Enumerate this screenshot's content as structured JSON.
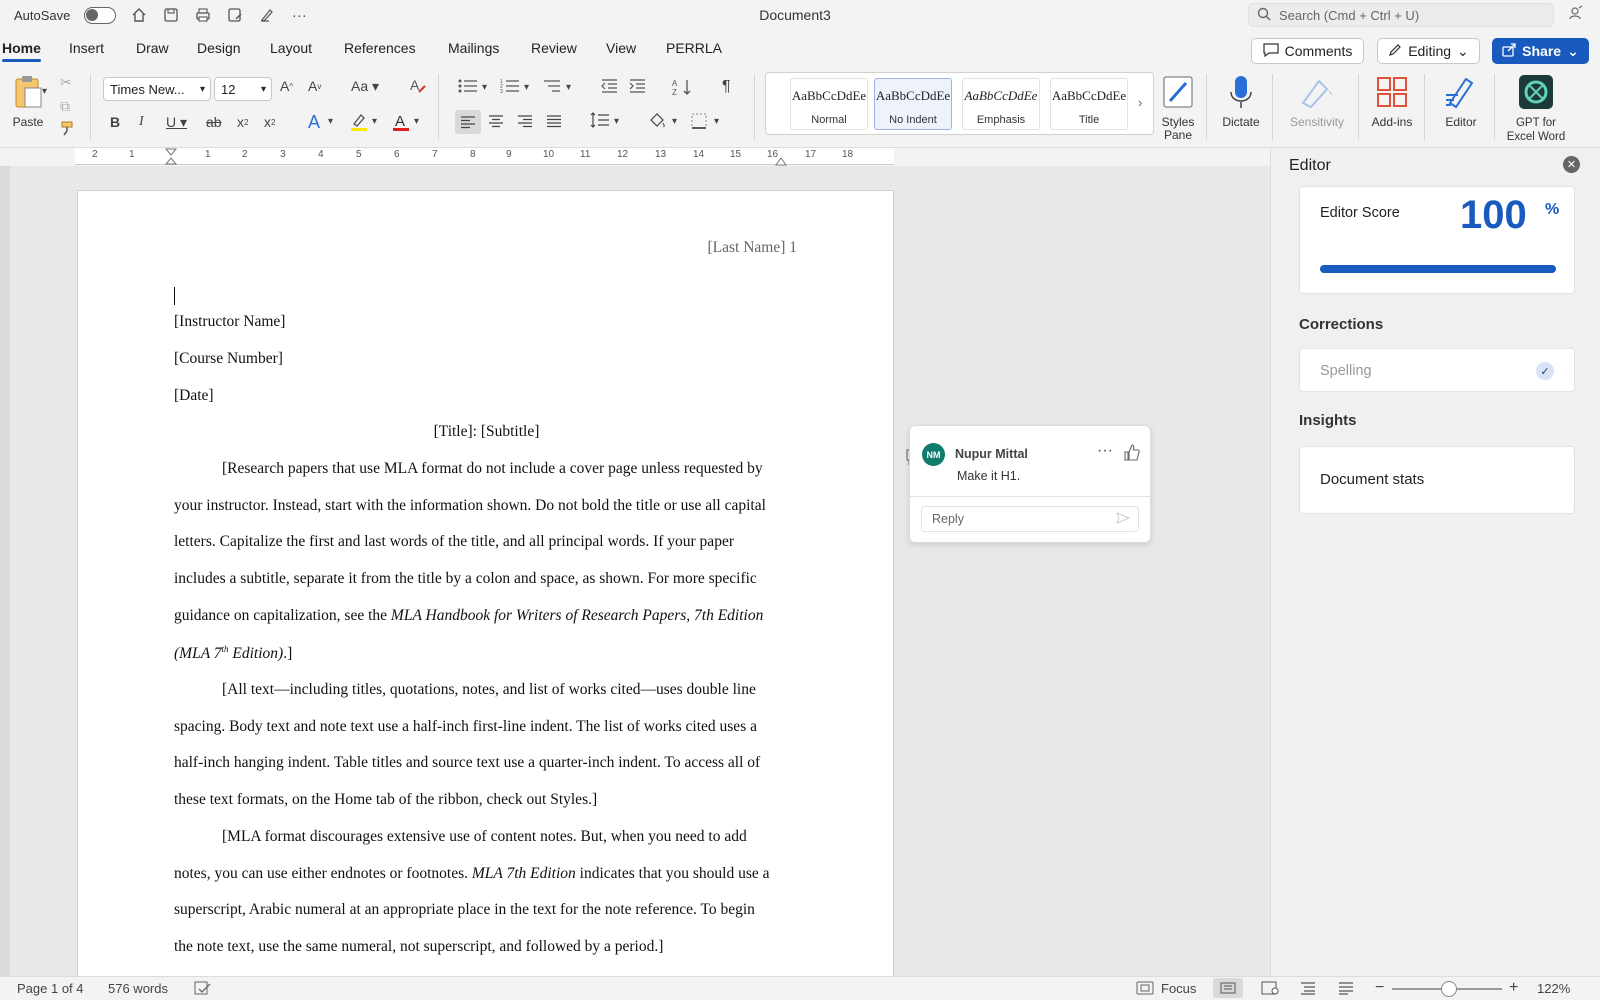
{
  "titlebar": {
    "autosave_label": "AutoSave",
    "document_title": "Document3",
    "search_placeholder": "Search (Cmd + Ctrl + U)",
    "icons": [
      "home-icon",
      "save-icon",
      "print-icon",
      "save-as-icon",
      "pen-icon",
      "more-icon"
    ]
  },
  "tabs": [
    "Home",
    "Insert",
    "Draw",
    "Design",
    "Layout",
    "References",
    "Mailings",
    "Review",
    "View",
    "PERRLA"
  ],
  "actions": {
    "comments": "Comments",
    "editing": "Editing",
    "share": "Share"
  },
  "ribbon": {
    "paste_label": "Paste",
    "font_name": "Times New...",
    "font_size": "12",
    "styles": [
      {
        "sample": "AaBbCcDdEe",
        "name": "Normal"
      },
      {
        "sample": "AaBbCcDdEe",
        "name": "No Indent"
      },
      {
        "sample": "AaBbCcDdEe",
        "name": "Emphasis"
      },
      {
        "sample": "AaBbCcDdEe",
        "name": "Title"
      }
    ],
    "styles_pane": "Styles\nPane",
    "dictate": "Dictate",
    "sensitivity": "Sensitivity",
    "addins": "Add-ins",
    "editor": "Editor",
    "gpt": "GPT for\nExcel Word"
  },
  "ruler": {
    "labels": [
      "2",
      "1",
      "1",
      "2",
      "3",
      "4",
      "5",
      "6",
      "7",
      "8",
      "9",
      "10",
      "11",
      "12",
      "13",
      "14",
      "15",
      "16",
      "17",
      "18"
    ]
  },
  "document": {
    "header": "[Last Name] 1",
    "lines": [
      "[Instructor Name]",
      "[Course Number]",
      "[Date]"
    ],
    "title_line": "[Title]: [Subtitle]",
    "para1": [
      "[Research papers that use MLA format do not include a cover page unless requested by",
      "your instructor. Instead, start with the information shown. Do not bold the title or use all capital",
      "letters. Capitalize the first and last words of the title, and all principal words. If your paper",
      "includes a subtitle, separate it from the title by a colon and space, as shown. For more specific"
    ],
    "para1_line5_prefix": "guidance on capitalization, see the ",
    "para1_line5_italic": "MLA Handbook for Writers of Research Papers, 7th Edition",
    "para1_line6_italic_a": "(MLA 7",
    "para1_line6_sup": "th",
    "para1_line6_italic_b": " Edition)",
    "para1_line6_end": ".]",
    "para2": [
      "[All text—including titles, quotations, notes, and list of works cited—uses double line",
      "spacing. Body text and note text use a half-inch first-line indent. The list of works cited uses a",
      "half-inch hanging indent. Table titles and source text use a quarter-inch indent. To access all of",
      "these text formats, on the Home tab of the ribbon, check out Styles.]"
    ],
    "para3_line1": "[MLA format discourages extensive use of content notes. But, when you need to add",
    "para3_line2_prefix": "notes, you can use either endnotes or footnotes. ",
    "para3_line2_italic": "MLA 7th Edition",
    "para3_line2_suffix": " indicates that you should use a",
    "para3_line3": "superscript, Arabic numeral at an appropriate place in the text for the note reference. To begin",
    "para3_line4": "the note text, use the same numeral, not superscript, and followed by a period.]"
  },
  "comment": {
    "initials": "NM",
    "author": "Nupur Mittal",
    "text": "Make it H1.",
    "reply_placeholder": "Reply"
  },
  "editor_pane": {
    "title": "Editor",
    "score_label": "Editor Score",
    "score_value": "100",
    "score_unit": "%",
    "score_fraction": 1.0,
    "corrections_heading": "Corrections",
    "spelling_label": "Spelling",
    "insights_heading": "Insights",
    "document_stats": "Document stats"
  },
  "statusbar": {
    "page": "Page 1 of 4",
    "words": "576 words",
    "focus": "Focus",
    "zoom": "122%"
  },
  "colors": {
    "accent": "#185abd",
    "avatar": "#0f7b6c"
  }
}
